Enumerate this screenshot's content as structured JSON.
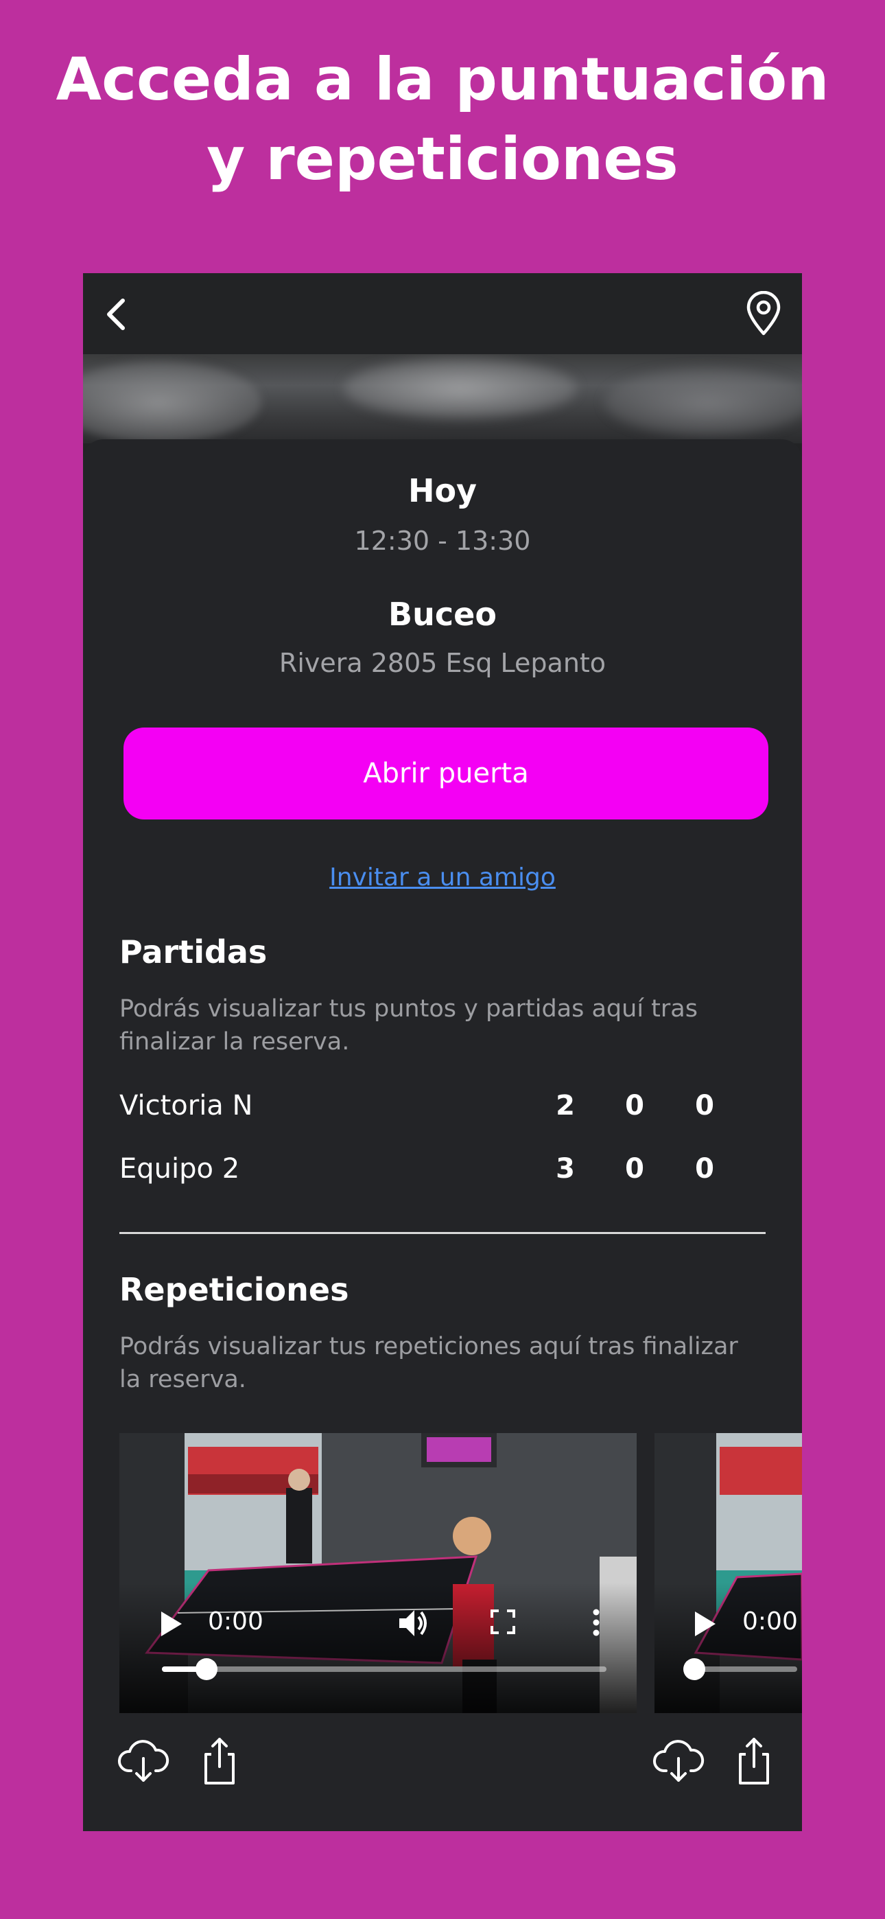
{
  "colors": {
    "background": "#bd2f9e",
    "accent": "#f400f4",
    "link": "#4a8ef0",
    "panel": "#232427"
  },
  "headline": {
    "line1": "Acceda a la puntuación",
    "line2": "y repeticiones"
  },
  "topbar": {
    "back_icon": "chevron-left-icon",
    "location_icon": "map-pin-icon"
  },
  "booking": {
    "day": "Hoy",
    "time": "12:30 - 13:30",
    "venue": "Buceo",
    "address": "Rivera 2805 Esq Lepanto"
  },
  "actions": {
    "open_door": "Abrir puerta",
    "invite": "Invitar a un amigo"
  },
  "matches": {
    "title": "Partidas",
    "note": "Podrás visualizar tus puntos y partidas aquí tras finalizar la reserva.",
    "rows": [
      {
        "player": "Victoria N",
        "scores": [
          "2",
          "0",
          "0"
        ]
      },
      {
        "player": "Equipo 2",
        "scores": [
          "3",
          "0",
          "0"
        ]
      }
    ]
  },
  "replays": {
    "title": "Repeticiones",
    "note": "Podrás visualizar tus repeticiones aquí tras finalizar la reserva.",
    "videos": [
      {
        "time": "0:00",
        "progress": 0.1,
        "download_icon": "cloud-download-icon",
        "share_icon": "share-icon"
      },
      {
        "time": "0:00",
        "progress": 0.0,
        "download_icon": "cloud-download-icon",
        "share_icon": "share-icon"
      }
    ]
  }
}
